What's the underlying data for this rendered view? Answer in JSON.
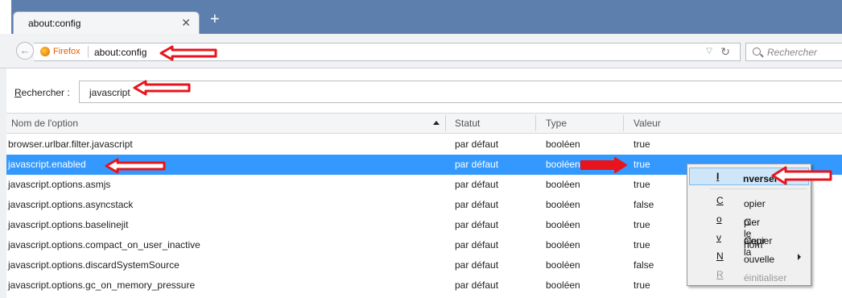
{
  "tab": {
    "title": "about:config"
  },
  "navbar": {
    "brand": "Firefox",
    "url": "about:config",
    "search_placeholder": "Rechercher"
  },
  "filter": {
    "label_prefix": "R",
    "label_rest": "echercher :",
    "value": "javascript"
  },
  "columns": [
    "Nom de l'option",
    "Statut",
    "Type",
    "Valeur"
  ],
  "rows": [
    {
      "name": "browser.urlbar.filter.javascript",
      "status": "par défaut",
      "type": "booléen",
      "value": "true"
    },
    {
      "name": "javascript.enabled",
      "status": "par défaut",
      "type": "booléen",
      "value": "true"
    },
    {
      "name": "javascript.options.asmjs",
      "status": "par défaut",
      "type": "booléen",
      "value": "true"
    },
    {
      "name": "javascript.options.asyncstack",
      "status": "par défaut",
      "type": "booléen",
      "value": "false"
    },
    {
      "name": "javascript.options.baselinejit",
      "status": "par défaut",
      "type": "booléen",
      "value": "true"
    },
    {
      "name": "javascript.options.compact_on_user_inactive",
      "status": "par défaut",
      "type": "booléen",
      "value": "true"
    },
    {
      "name": "javascript.options.discardSystemSource",
      "status": "par défaut",
      "type": "booléen",
      "value": "false"
    },
    {
      "name": "javascript.options.gc_on_memory_pressure",
      "status": "par défaut",
      "type": "booléen",
      "value": "true"
    }
  ],
  "context_menu": {
    "items": [
      {
        "pre": "",
        "u": "I",
        "post": "nverser"
      },
      {
        "pre": "",
        "u": "C",
        "post": "opier"
      },
      {
        "pre": "C",
        "u": "o",
        "post": "pier le nom"
      },
      {
        "pre": "Copier la ",
        "u": "v",
        "post": "aleur"
      },
      {
        "pre": "",
        "u": "N",
        "post": "ouvelle"
      },
      {
        "pre": "",
        "u": "R",
        "post": "éinitialiser"
      }
    ]
  },
  "colors": {
    "selection": "#3399ff",
    "tabbar": "#5d7fae",
    "annotation_arrow": "#e8141c"
  },
  "icons": [
    "close-icon",
    "new-tab-icon",
    "back-icon",
    "firefox-icon",
    "dropdown-icon",
    "reload-icon",
    "search-icon",
    "sort-ascending-icon",
    "submenu-arrow-icon"
  ]
}
